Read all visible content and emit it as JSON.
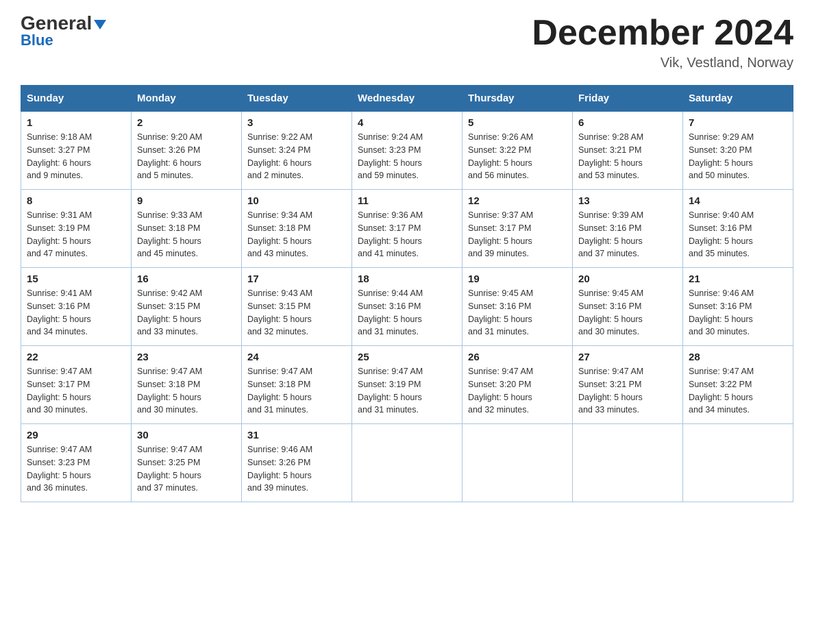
{
  "logo": {
    "part1": "General",
    "part2": "Blue"
  },
  "title": "December 2024",
  "location": "Vik, Vestland, Norway",
  "weekdays": [
    "Sunday",
    "Monday",
    "Tuesday",
    "Wednesday",
    "Thursday",
    "Friday",
    "Saturday"
  ],
  "weeks": [
    [
      {
        "day": "1",
        "sunrise": "9:18 AM",
        "sunset": "3:27 PM",
        "daylight": "6 hours and 9 minutes."
      },
      {
        "day": "2",
        "sunrise": "9:20 AM",
        "sunset": "3:26 PM",
        "daylight": "6 hours and 5 minutes."
      },
      {
        "day": "3",
        "sunrise": "9:22 AM",
        "sunset": "3:24 PM",
        "daylight": "6 hours and 2 minutes."
      },
      {
        "day": "4",
        "sunrise": "9:24 AM",
        "sunset": "3:23 PM",
        "daylight": "5 hours and 59 minutes."
      },
      {
        "day": "5",
        "sunrise": "9:26 AM",
        "sunset": "3:22 PM",
        "daylight": "5 hours and 56 minutes."
      },
      {
        "day": "6",
        "sunrise": "9:28 AM",
        "sunset": "3:21 PM",
        "daylight": "5 hours and 53 minutes."
      },
      {
        "day": "7",
        "sunrise": "9:29 AM",
        "sunset": "3:20 PM",
        "daylight": "5 hours and 50 minutes."
      }
    ],
    [
      {
        "day": "8",
        "sunrise": "9:31 AM",
        "sunset": "3:19 PM",
        "daylight": "5 hours and 47 minutes."
      },
      {
        "day": "9",
        "sunrise": "9:33 AM",
        "sunset": "3:18 PM",
        "daylight": "5 hours and 45 minutes."
      },
      {
        "day": "10",
        "sunrise": "9:34 AM",
        "sunset": "3:18 PM",
        "daylight": "5 hours and 43 minutes."
      },
      {
        "day": "11",
        "sunrise": "9:36 AM",
        "sunset": "3:17 PM",
        "daylight": "5 hours and 41 minutes."
      },
      {
        "day": "12",
        "sunrise": "9:37 AM",
        "sunset": "3:17 PM",
        "daylight": "5 hours and 39 minutes."
      },
      {
        "day": "13",
        "sunrise": "9:39 AM",
        "sunset": "3:16 PM",
        "daylight": "5 hours and 37 minutes."
      },
      {
        "day": "14",
        "sunrise": "9:40 AM",
        "sunset": "3:16 PM",
        "daylight": "5 hours and 35 minutes."
      }
    ],
    [
      {
        "day": "15",
        "sunrise": "9:41 AM",
        "sunset": "3:16 PM",
        "daylight": "5 hours and 34 minutes."
      },
      {
        "day": "16",
        "sunrise": "9:42 AM",
        "sunset": "3:15 PM",
        "daylight": "5 hours and 33 minutes."
      },
      {
        "day": "17",
        "sunrise": "9:43 AM",
        "sunset": "3:15 PM",
        "daylight": "5 hours and 32 minutes."
      },
      {
        "day": "18",
        "sunrise": "9:44 AM",
        "sunset": "3:16 PM",
        "daylight": "5 hours and 31 minutes."
      },
      {
        "day": "19",
        "sunrise": "9:45 AM",
        "sunset": "3:16 PM",
        "daylight": "5 hours and 31 minutes."
      },
      {
        "day": "20",
        "sunrise": "9:45 AM",
        "sunset": "3:16 PM",
        "daylight": "5 hours and 30 minutes."
      },
      {
        "day": "21",
        "sunrise": "9:46 AM",
        "sunset": "3:16 PM",
        "daylight": "5 hours and 30 minutes."
      }
    ],
    [
      {
        "day": "22",
        "sunrise": "9:47 AM",
        "sunset": "3:17 PM",
        "daylight": "5 hours and 30 minutes."
      },
      {
        "day": "23",
        "sunrise": "9:47 AM",
        "sunset": "3:18 PM",
        "daylight": "5 hours and 30 minutes."
      },
      {
        "day": "24",
        "sunrise": "9:47 AM",
        "sunset": "3:18 PM",
        "daylight": "5 hours and 31 minutes."
      },
      {
        "day": "25",
        "sunrise": "9:47 AM",
        "sunset": "3:19 PM",
        "daylight": "5 hours and 31 minutes."
      },
      {
        "day": "26",
        "sunrise": "9:47 AM",
        "sunset": "3:20 PM",
        "daylight": "5 hours and 32 minutes."
      },
      {
        "day": "27",
        "sunrise": "9:47 AM",
        "sunset": "3:21 PM",
        "daylight": "5 hours and 33 minutes."
      },
      {
        "day": "28",
        "sunrise": "9:47 AM",
        "sunset": "3:22 PM",
        "daylight": "5 hours and 34 minutes."
      }
    ],
    [
      {
        "day": "29",
        "sunrise": "9:47 AM",
        "sunset": "3:23 PM",
        "daylight": "5 hours and 36 minutes."
      },
      {
        "day": "30",
        "sunrise": "9:47 AM",
        "sunset": "3:25 PM",
        "daylight": "5 hours and 37 minutes."
      },
      {
        "day": "31",
        "sunrise": "9:46 AM",
        "sunset": "3:26 PM",
        "daylight": "5 hours and 39 minutes."
      },
      null,
      null,
      null,
      null
    ]
  ],
  "labels": {
    "sunrise": "Sunrise:",
    "sunset": "Sunset:",
    "daylight": "Daylight:"
  }
}
